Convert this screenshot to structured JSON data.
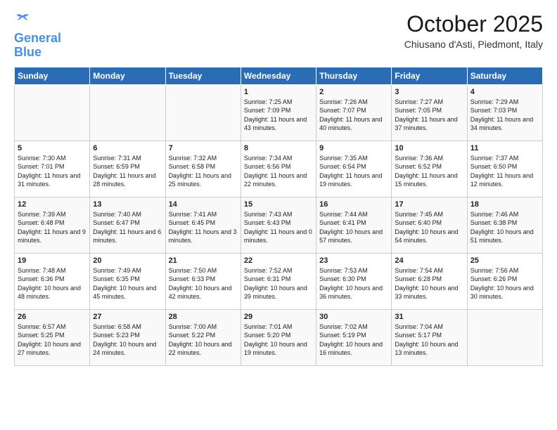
{
  "header": {
    "logo_line1": "General",
    "logo_line2": "Blue",
    "month": "October 2025",
    "location": "Chiusano d'Asti, Piedmont, Italy"
  },
  "weekdays": [
    "Sunday",
    "Monday",
    "Tuesday",
    "Wednesday",
    "Thursday",
    "Friday",
    "Saturday"
  ],
  "weeks": [
    [
      {
        "day": "",
        "text": ""
      },
      {
        "day": "",
        "text": ""
      },
      {
        "day": "",
        "text": ""
      },
      {
        "day": "1",
        "text": "Sunrise: 7:25 AM\nSunset: 7:09 PM\nDaylight: 11 hours and 43 minutes."
      },
      {
        "day": "2",
        "text": "Sunrise: 7:26 AM\nSunset: 7:07 PM\nDaylight: 11 hours and 40 minutes."
      },
      {
        "day": "3",
        "text": "Sunrise: 7:27 AM\nSunset: 7:05 PM\nDaylight: 11 hours and 37 minutes."
      },
      {
        "day": "4",
        "text": "Sunrise: 7:29 AM\nSunset: 7:03 PM\nDaylight: 11 hours and 34 minutes."
      }
    ],
    [
      {
        "day": "5",
        "text": "Sunrise: 7:30 AM\nSunset: 7:01 PM\nDaylight: 11 hours and 31 minutes."
      },
      {
        "day": "6",
        "text": "Sunrise: 7:31 AM\nSunset: 6:59 PM\nDaylight: 11 hours and 28 minutes."
      },
      {
        "day": "7",
        "text": "Sunrise: 7:32 AM\nSunset: 6:58 PM\nDaylight: 11 hours and 25 minutes."
      },
      {
        "day": "8",
        "text": "Sunrise: 7:34 AM\nSunset: 6:56 PM\nDaylight: 11 hours and 22 minutes."
      },
      {
        "day": "9",
        "text": "Sunrise: 7:35 AM\nSunset: 6:54 PM\nDaylight: 11 hours and 19 minutes."
      },
      {
        "day": "10",
        "text": "Sunrise: 7:36 AM\nSunset: 6:52 PM\nDaylight: 11 hours and 15 minutes."
      },
      {
        "day": "11",
        "text": "Sunrise: 7:37 AM\nSunset: 6:50 PM\nDaylight: 11 hours and 12 minutes."
      }
    ],
    [
      {
        "day": "12",
        "text": "Sunrise: 7:39 AM\nSunset: 6:48 PM\nDaylight: 11 hours and 9 minutes."
      },
      {
        "day": "13",
        "text": "Sunrise: 7:40 AM\nSunset: 6:47 PM\nDaylight: 11 hours and 6 minutes."
      },
      {
        "day": "14",
        "text": "Sunrise: 7:41 AM\nSunset: 6:45 PM\nDaylight: 11 hours and 3 minutes."
      },
      {
        "day": "15",
        "text": "Sunrise: 7:43 AM\nSunset: 6:43 PM\nDaylight: 11 hours and 0 minutes."
      },
      {
        "day": "16",
        "text": "Sunrise: 7:44 AM\nSunset: 6:41 PM\nDaylight: 10 hours and 57 minutes."
      },
      {
        "day": "17",
        "text": "Sunrise: 7:45 AM\nSunset: 6:40 PM\nDaylight: 10 hours and 54 minutes."
      },
      {
        "day": "18",
        "text": "Sunrise: 7:46 AM\nSunset: 6:38 PM\nDaylight: 10 hours and 51 minutes."
      }
    ],
    [
      {
        "day": "19",
        "text": "Sunrise: 7:48 AM\nSunset: 6:36 PM\nDaylight: 10 hours and 48 minutes."
      },
      {
        "day": "20",
        "text": "Sunrise: 7:49 AM\nSunset: 6:35 PM\nDaylight: 10 hours and 45 minutes."
      },
      {
        "day": "21",
        "text": "Sunrise: 7:50 AM\nSunset: 6:33 PM\nDaylight: 10 hours and 42 minutes."
      },
      {
        "day": "22",
        "text": "Sunrise: 7:52 AM\nSunset: 6:31 PM\nDaylight: 10 hours and 39 minutes."
      },
      {
        "day": "23",
        "text": "Sunrise: 7:53 AM\nSunset: 6:30 PM\nDaylight: 10 hours and 36 minutes."
      },
      {
        "day": "24",
        "text": "Sunrise: 7:54 AM\nSunset: 6:28 PM\nDaylight: 10 hours and 33 minutes."
      },
      {
        "day": "25",
        "text": "Sunrise: 7:56 AM\nSunset: 6:26 PM\nDaylight: 10 hours and 30 minutes."
      }
    ],
    [
      {
        "day": "26",
        "text": "Sunrise: 6:57 AM\nSunset: 5:25 PM\nDaylight: 10 hours and 27 minutes."
      },
      {
        "day": "27",
        "text": "Sunrise: 6:58 AM\nSunset: 5:23 PM\nDaylight: 10 hours and 24 minutes."
      },
      {
        "day": "28",
        "text": "Sunrise: 7:00 AM\nSunset: 5:22 PM\nDaylight: 10 hours and 22 minutes."
      },
      {
        "day": "29",
        "text": "Sunrise: 7:01 AM\nSunset: 5:20 PM\nDaylight: 10 hours and 19 minutes."
      },
      {
        "day": "30",
        "text": "Sunrise: 7:02 AM\nSunset: 5:19 PM\nDaylight: 10 hours and 16 minutes."
      },
      {
        "day": "31",
        "text": "Sunrise: 7:04 AM\nSunset: 5:17 PM\nDaylight: 10 hours and 13 minutes."
      },
      {
        "day": "",
        "text": ""
      }
    ]
  ]
}
